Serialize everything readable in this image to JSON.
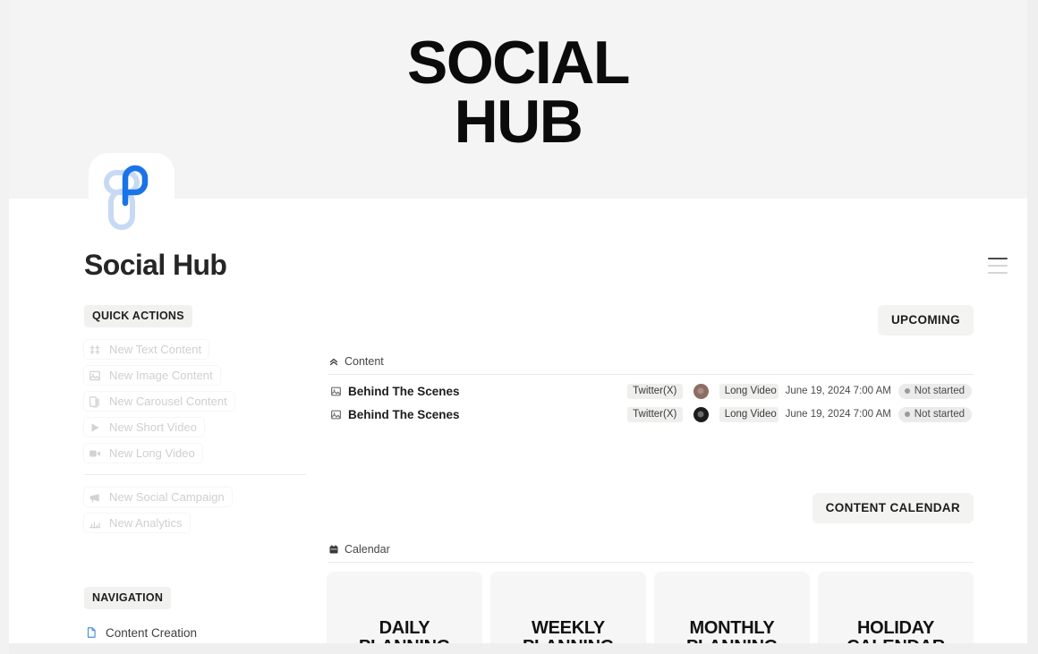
{
  "cover": {
    "banner_text": "SOCIAL\nHUB",
    "background_color": "#f4f4f4"
  },
  "page": {
    "icon_name": "social-hub-logo",
    "icon_colors": {
      "primary": "#1a73e8",
      "secondary": "#c7d9f5"
    },
    "title": "Social Hub"
  },
  "menu": {
    "icon_name": "hamburger-menu-icon"
  },
  "sidebar": {
    "quick_actions": {
      "heading": "QUICK ACTIONS",
      "items": [
        {
          "label": "New Text Content",
          "icon": "text-quote-icon"
        },
        {
          "label": "New Image Content",
          "icon": "image-icon"
        },
        {
          "label": "New Carousel Content",
          "icon": "carousel-copy-icon"
        },
        {
          "label": "New Short Video",
          "icon": "play-triangle-icon"
        },
        {
          "label": "New Long Video",
          "icon": "video-camera-icon"
        }
      ],
      "items_secondary": [
        {
          "label": "New Social Campaign",
          "icon": "megaphone-icon"
        },
        {
          "label": "New Analytics",
          "icon": "bar-chart-icon"
        }
      ]
    },
    "navigation": {
      "heading": "NAVIGATION",
      "items": [
        {
          "label": "Content Creation",
          "icon": "document-page-icon"
        }
      ]
    }
  },
  "main": {
    "upcoming_button": "UPCOMING",
    "content_calendar_button": "CONTENT CALENDAR",
    "content_db": {
      "heading": "Content",
      "heading_icon": "double-chevron-up-icon",
      "rows": [
        {
          "icon": "image-icon",
          "name": "Behind The Scenes",
          "platform": "Twitter(X)",
          "avatar": "light",
          "type": "Long Video",
          "date": "June 19, 2024 7:00 AM",
          "status": "Not started"
        },
        {
          "icon": "image-icon",
          "name": "Behind The Scenes",
          "platform": "Twitter(X)",
          "avatar": "dark",
          "type": "Long Video",
          "date": "June 19, 2024 7:00 AM",
          "status": "Not started"
        }
      ]
    },
    "calendar_db": {
      "heading": "Calendar",
      "heading_icon": "calendar-icon",
      "cards": [
        {
          "label": "DAILY\nPLANNING"
        },
        {
          "label": "WEEKLY\nPLANNING"
        },
        {
          "label": "MONTHLY\nPLANNING"
        },
        {
          "label": "HOLIDAY\nCALENDAR"
        }
      ]
    }
  }
}
